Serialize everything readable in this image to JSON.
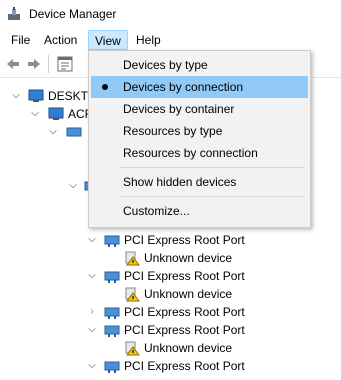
{
  "window": {
    "title": "Device Manager"
  },
  "menubar": [
    {
      "label": "File"
    },
    {
      "label": "Action"
    },
    {
      "label": "View",
      "active": true
    },
    {
      "label": "Help"
    }
  ],
  "toolbar": {
    "buttons": [
      "back-icon",
      "forward-icon",
      "properties-icon"
    ]
  },
  "tree": {
    "root_label": "DESKTO",
    "acpi_label": "ACF",
    "rows": [
      {
        "label": "PCI Express Root Port",
        "expanded": "open"
      },
      {
        "label": "Unknown device",
        "warning": true
      },
      {
        "label": "PCI Express Root Port",
        "expanded": "open"
      },
      {
        "label": "Unknown device",
        "warning": true
      },
      {
        "label": "PCI Express Root Port",
        "expanded": "closed"
      },
      {
        "label": "PCI Express Root Port",
        "expanded": "open"
      },
      {
        "label": "Unknown device",
        "warning": true
      },
      {
        "label": "PCI Express Root Port",
        "expanded": "open"
      }
    ]
  },
  "view_menu": {
    "items": [
      {
        "label": "Devices by type"
      },
      {
        "label": "Devices by connection",
        "selected": true
      },
      {
        "label": "Devices by container"
      },
      {
        "label": "Resources by type"
      },
      {
        "label": "Resources by connection"
      },
      {
        "label": "Show hidden devices"
      },
      {
        "label": "Customize..."
      }
    ]
  },
  "colors": {
    "menu_highlight": "#91c9f7",
    "menubar_active": "#cce8ff",
    "warning": "#f2c811"
  }
}
